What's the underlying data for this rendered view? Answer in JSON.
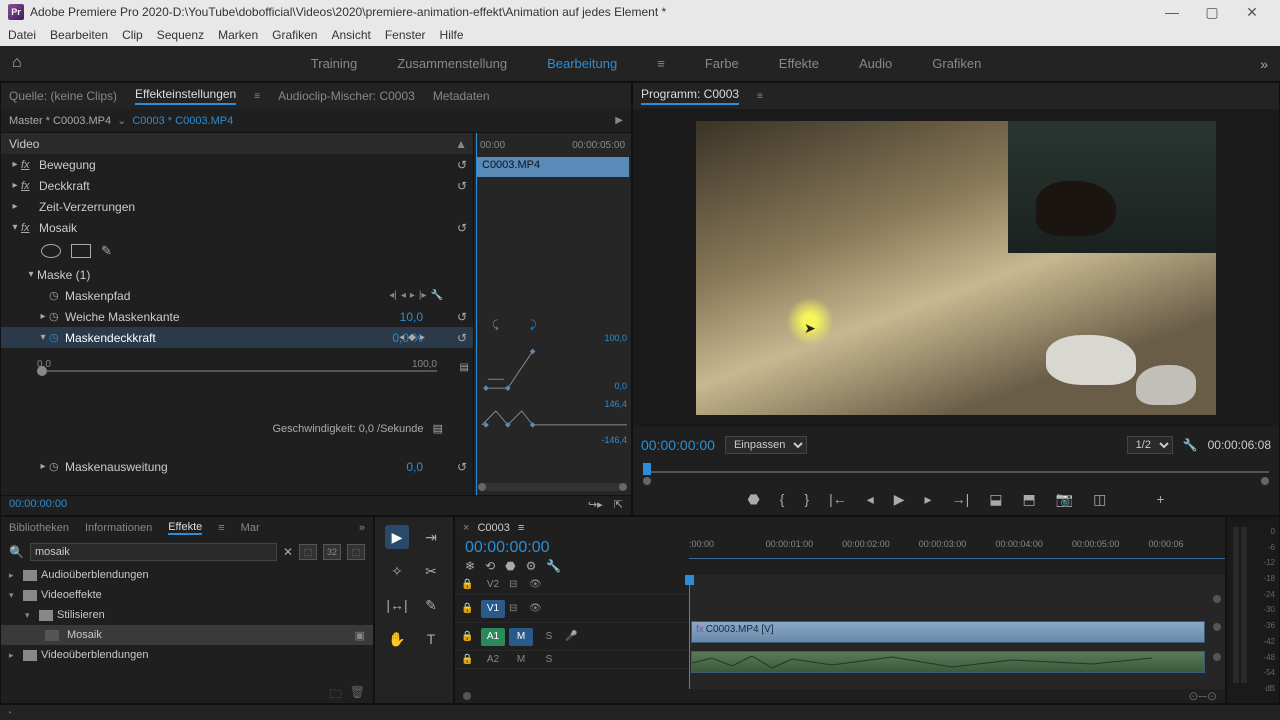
{
  "titlebar": {
    "app": "Adobe Premiere Pro 2020",
    "sep": " - ",
    "path": "D:\\YouTube\\dobofficial\\Videos\\2020\\premiere-animation-effekt\\Animation auf jedes Element *",
    "logo": "Pr"
  },
  "menu": [
    "Datei",
    "Bearbeiten",
    "Clip",
    "Sequenz",
    "Marken",
    "Grafiken",
    "Ansicht",
    "Fenster",
    "Hilfe"
  ],
  "workspace": {
    "tabs": [
      "Training",
      "Zusammenstellung",
      "Bearbeitung",
      "Farbe",
      "Effekte",
      "Audio",
      "Grafiken"
    ],
    "active": "Bearbeitung"
  },
  "sourcePanel": {
    "tabs": {
      "source": "Quelle: (keine Clips)",
      "effects": "Effekteinstellungen",
      "mixer": "Audioclip-Mischer: C0003",
      "meta": "Metadaten"
    },
    "master": "Master * C0003.MP4",
    "clipref": "C0003 * C0003.MP4",
    "timeStart": "00:00",
    "timeEnd": "00:00:05:00",
    "clipLabel": "C0003.MP4",
    "videoHeader": "Video",
    "props": {
      "motion": "Bewegung",
      "opacity": "Deckkraft",
      "timeremap": "Zeit-Verzerrungen",
      "mosaic": "Mosaik",
      "mask": "Maske (1)",
      "maskpath": "Maskenpfad",
      "feather": "Weiche Maskenkante",
      "featherVal": "10,0",
      "maskopacity": "Maskendeckkraft",
      "maskopacityVal": "0,0 %",
      "sliderMin": "0,0",
      "sliderMax": "100,0",
      "gmax": "100,0",
      "gzero": "0,0",
      "vmax": "146,4",
      "vmin": "-146,4",
      "speed": "Geschwindigkeit: 0,0 /Sekunde",
      "expansion": "Maskenausweitung",
      "expansionVal": "0,0"
    },
    "footerTime": "00:00:00:00"
  },
  "programPanel": {
    "title": "Programm: C0003",
    "tc": "00:00:00:00",
    "fit": "Einpassen",
    "res": "1/2",
    "dur": "00:00:06:08"
  },
  "effectsBrowser": {
    "tabs": [
      "Bibliotheken",
      "Informationen",
      "Effekte",
      "Mar"
    ],
    "search": "mosaik",
    "tree": {
      "audio": "Audioüberblendungen",
      "video": "Videoeffekte",
      "stylize": "Stilisieren",
      "mosaic": "Mosaik",
      "vtrans": "Videoüberblendungen"
    },
    "presets": [
      "⬚",
      "32",
      "⬚"
    ]
  },
  "timeline": {
    "seq": "C0003",
    "tc": "00:00:00:00",
    "ruler": [
      ":00:00",
      "00:00:01:00",
      "00:00:02:00",
      "00:00:03:00",
      "00:00:04:00",
      "00:00:05:00",
      "00:00:06"
    ],
    "v2": "V2",
    "v1": "V1",
    "a1": "A1",
    "a2": "A2",
    "m": "M",
    "s": "S",
    "clip": "C0003.MP4 [V]"
  },
  "meter": [
    "0",
    "-6",
    "-12",
    "-18",
    "-24",
    "-30",
    "-36",
    "-42",
    "-48",
    "-54",
    "dB"
  ]
}
